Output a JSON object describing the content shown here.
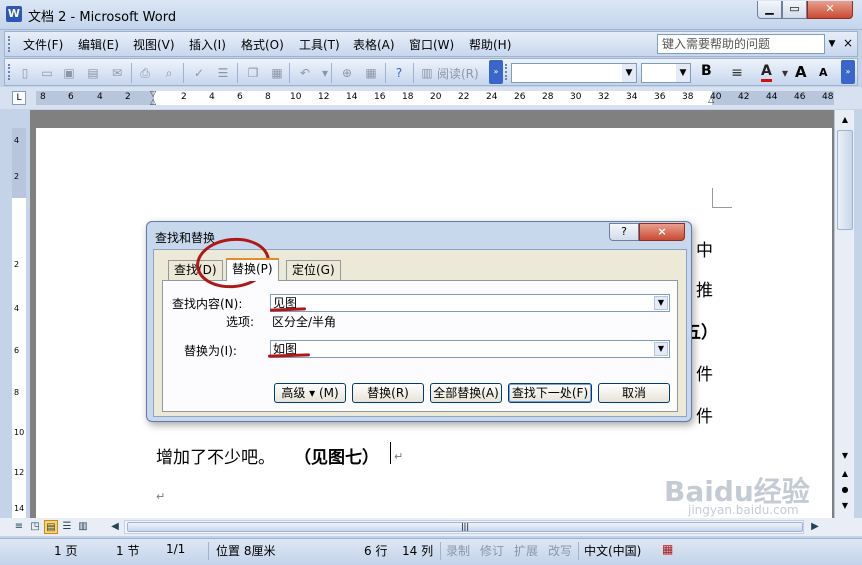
{
  "window": {
    "title": "文档 2 - Microsoft Word",
    "app_icon": "W"
  },
  "menubar": {
    "items": [
      "文件(F)",
      "编辑(E)",
      "视图(V)",
      "插入(I)",
      "格式(O)",
      "工具(T)",
      "表格(A)",
      "窗口(W)",
      "帮助(H)"
    ],
    "help_placeholder": "键入需要帮助的问题",
    "close_glyph": "×"
  },
  "toolbar": {
    "read_label": "阅读(R)",
    "bold": "B",
    "font_color": "A",
    "grow": "A",
    "shrink": "A"
  },
  "ruler": {
    "numbers": [
      "8",
      "6",
      "4",
      "2",
      "2",
      "4",
      "6",
      "8",
      "10",
      "12",
      "14",
      "16",
      "18",
      "20",
      "22",
      "24",
      "26",
      "28",
      "30",
      "32",
      "34",
      "36",
      "38",
      "40",
      "42",
      "44",
      "46",
      "48"
    ],
    "vnumbers": [
      "4",
      "2",
      "2",
      "4",
      "6",
      "8",
      "10",
      "12",
      "14"
    ]
  },
  "document": {
    "lines": [
      {
        "text": "中",
        "bold": false
      },
      {
        "text": "推",
        "bold": false
      },
      {
        "text": "五）",
        "bold": true
      },
      {
        "text": "件",
        "bold": false
      },
      {
        "text": "件",
        "bold": false
      }
    ],
    "last_line_normal": "增加了不少吧。",
    "last_line_bold": "（见图七）",
    "para_mark": "↵"
  },
  "dialog": {
    "title": "查找和替换",
    "help_glyph": "?",
    "close_glyph": "×",
    "tabs": [
      "查找(D)",
      "替换(P)",
      "定位(G)"
    ],
    "find_label": "查找内容(N):",
    "find_value": "见图",
    "options_label": "选项:",
    "options_value": "区分全/半角",
    "replace_label": "替换为(I):",
    "replace_value": "如图",
    "buttons": {
      "advanced": "高级 ▾ (M)",
      "replace": "替换(R)",
      "replace_all": "全部替换(A)",
      "find_next": "查找下一处(F)",
      "cancel": "取消"
    }
  },
  "statusbar": {
    "page": "1 页",
    "section": "1 节",
    "page_of": "1/1",
    "position": "位置 8厘米",
    "line": "6 行",
    "column": "14 列",
    "rec": "录制",
    "trk": "修订",
    "ext": "扩展",
    "ovr": "改写",
    "language": "中文(中国)"
  },
  "watermark": {
    "brand": "Baidu经验",
    "url": "jingyan.baidu.com"
  }
}
